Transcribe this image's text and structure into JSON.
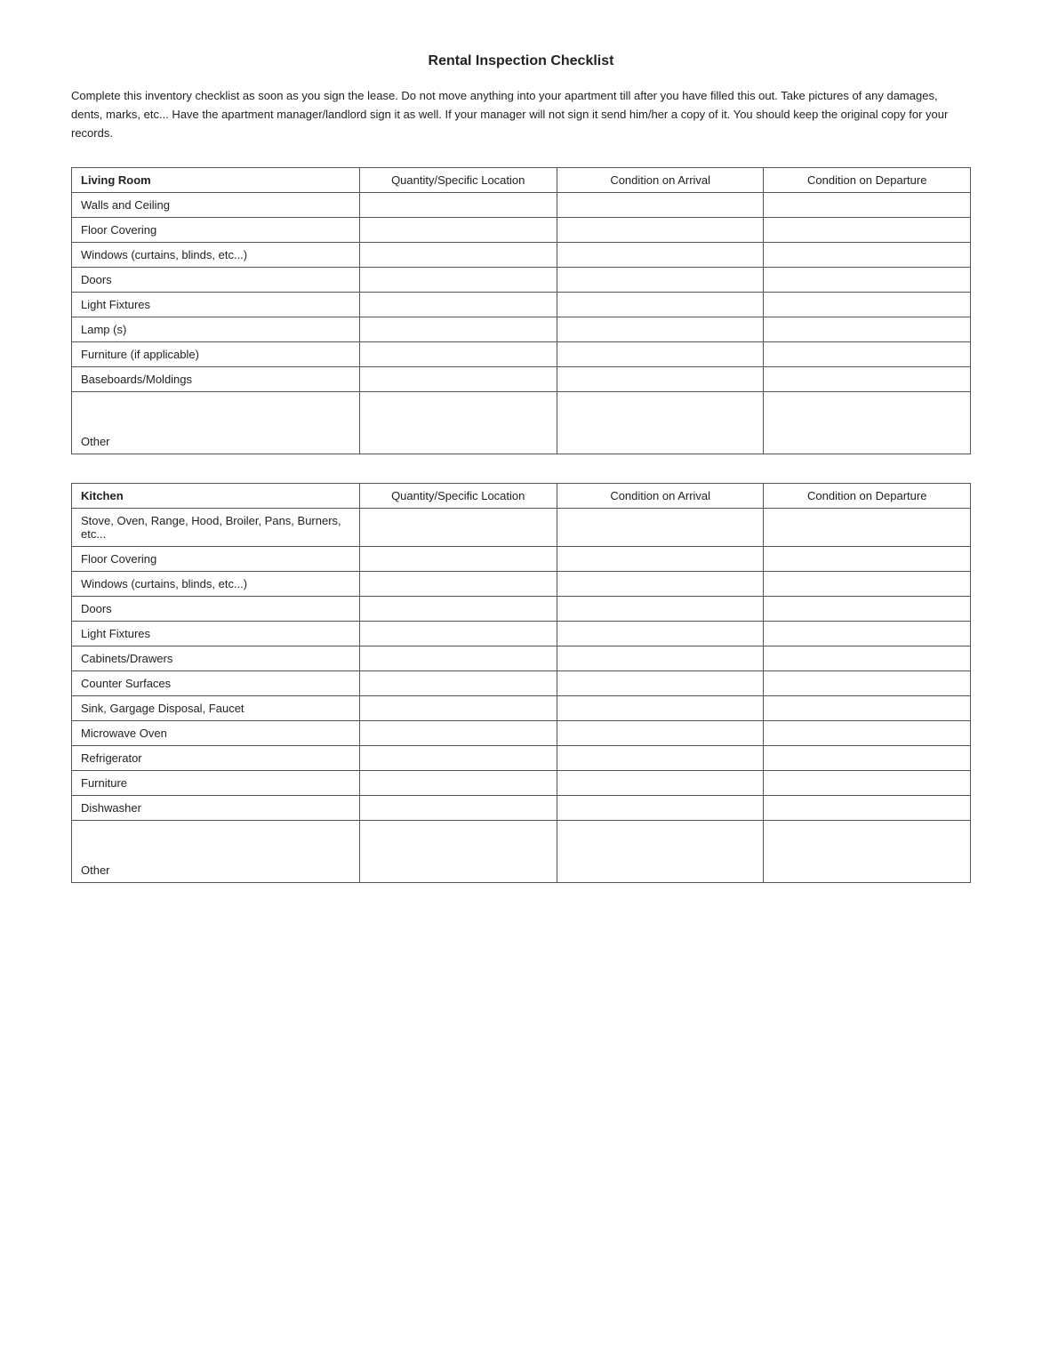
{
  "title": "Rental Inspection Checklist",
  "intro": "Complete this inventory checklist as soon as you sign the lease.  Do not move anything into your apartment till after you have filled this out.  Take pictures of any damages, dents, marks, etc... Have the apartment manager/landlord sign it as well.  If your manager will not sign it send him/her a copy of it.  You should keep the original copy for your records.",
  "columns": {
    "item": "",
    "qty": "Quantity/Specific Location",
    "arrival": "Condition on Arrival",
    "departure": "Condition on Departure"
  },
  "living_room": {
    "header": "Living Room",
    "rows": [
      "Walls and Ceiling",
      "Floor Covering",
      "Windows (curtains, blinds, etc...)",
      "Doors",
      "Light Fixtures",
      "Lamp (s)",
      "Furniture (if applicable)",
      "Baseboards/Moldings",
      "Other"
    ]
  },
  "kitchen": {
    "header": "Kitchen",
    "rows": [
      "Stove, Oven, Range, Hood, Broiler, Pans, Burners, etc...",
      "Floor Covering",
      "Windows (curtains, blinds, etc...)",
      "Doors",
      "Light Fixtures",
      "Cabinets/Drawers",
      "Counter Surfaces",
      "Sink, Gargage Disposal, Faucet",
      "Microwave Oven",
      "Refrigerator",
      "Furniture",
      "Dishwasher",
      "Other"
    ]
  }
}
